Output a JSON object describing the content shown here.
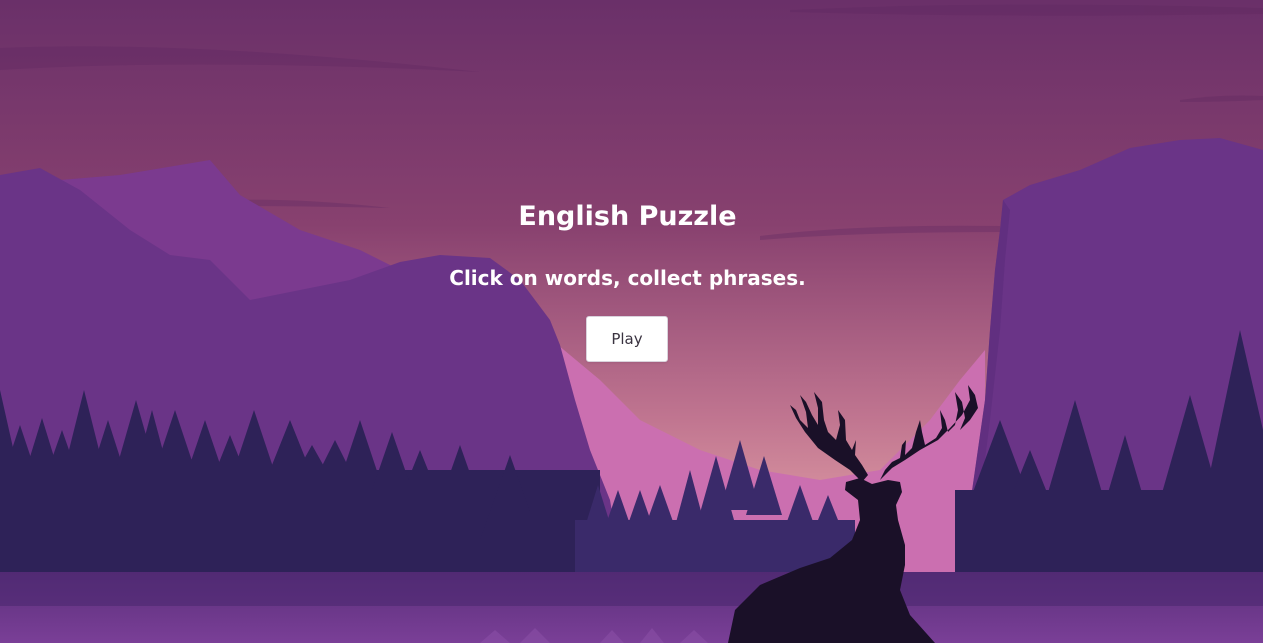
{
  "start_screen": {
    "title": "English Puzzle",
    "subtitle": "Click on words, collect phrases.",
    "play_label": "Play"
  },
  "background": {
    "scene": "mountain-lake-deer-silhouette",
    "colors": {
      "sky_top": "#6a3069",
      "sky_horizon": "#e7a0a8",
      "mountains": "#7a3f8f",
      "forest": "#2e2258",
      "deer": "#1a1028",
      "water": "#6a3c8a"
    }
  }
}
